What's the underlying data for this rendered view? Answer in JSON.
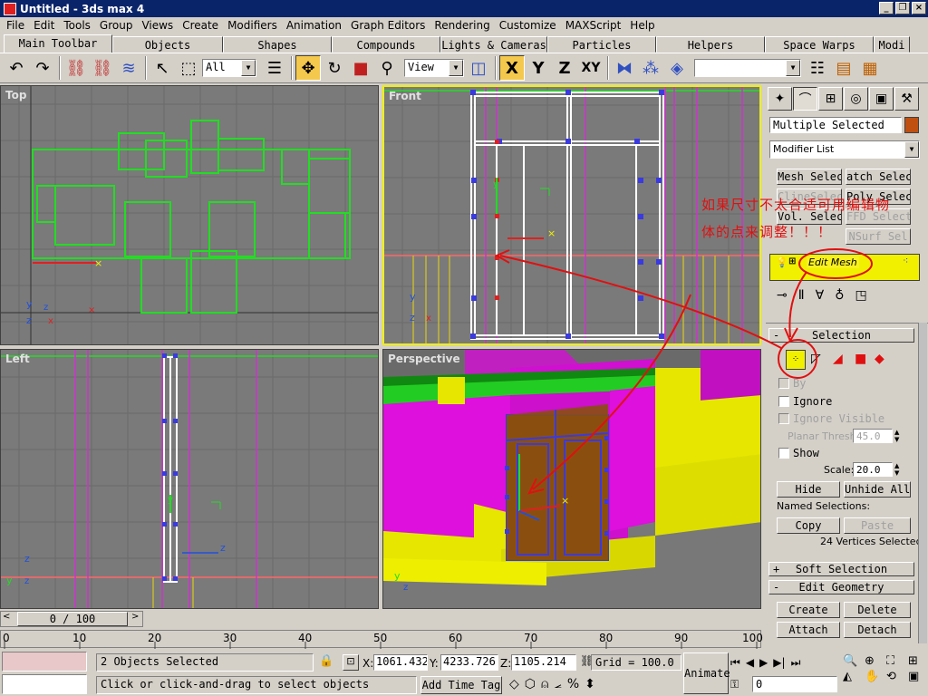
{
  "window": {
    "title": "Untitled - 3ds max 4",
    "minimize": "_",
    "restore": "❐",
    "close": "×"
  },
  "menu": [
    "File",
    "Edit",
    "Tools",
    "Group",
    "Views",
    "Create",
    "Modifiers",
    "Animation",
    "Graph Editors",
    "Rendering",
    "Customize",
    "MAXScript",
    "Help"
  ],
  "tabs": [
    "Main Toolbar",
    "Objects",
    "Shapes",
    "Compounds",
    "Lights & Cameras",
    "Particles",
    "Helpers",
    "Space Warps",
    "Modi"
  ],
  "toolbar": {
    "selection_filter": "All",
    "ref_coord": "View",
    "axis_x": "X",
    "axis_y": "Y",
    "axis_z": "Z",
    "axis_xy": "XY"
  },
  "viewports": {
    "top": "Top",
    "front": "Front",
    "left": "Left",
    "perspective": "Perspective"
  },
  "command_panel": {
    "object_name": "Multiple Selected",
    "modifier_list": "Modifier List",
    "modifier_buttons": [
      "Mesh Select",
      "atch Selec",
      "ClineSelec",
      "Poly Selec",
      "Vol. Select",
      "FFD Select",
      "NSurf Sel"
    ],
    "stack_item": "Edit Mesh",
    "selection_title": "Selection",
    "by_label": "By",
    "ignore_backfacing": "Ignore",
    "ignore_visible": "Ignore Visible",
    "planar_thresh_label": "Planar Thresh:",
    "planar_thresh_value": "45.0",
    "show_label": "Show",
    "scale_label": "Scale:",
    "scale_value": "20.0",
    "hide": "Hide",
    "unhide_all": "Unhide All",
    "named_selections": "Named Selections:",
    "copy": "Copy",
    "paste": "Paste",
    "vertices_selected": "24 Vertices Selected",
    "soft_selection": "Soft Selection",
    "edit_geometry": "Edit Geometry",
    "create": "Create",
    "delete": "Delete",
    "attach": "Attach",
    "detach": "Detach"
  },
  "annotation": {
    "line1": "如果尺寸不太合适可用编辑物",
    "line2": "体的点来调整！！！"
  },
  "timeline": {
    "frame_counter": "0 / 100",
    "ticks": [
      "0",
      "10",
      "20",
      "30",
      "40",
      "50",
      "60",
      "70",
      "80",
      "90",
      "100"
    ]
  },
  "status": {
    "objects_selected": "2 Objects Selected",
    "prompt": "Click or click-and-drag to select objects",
    "add_time_tag": "Add Time Tag",
    "x_label": "X:",
    "x_value": "1061.432",
    "y_label": "Y:",
    "y_value": "4233.726",
    "z_label": "Z:",
    "z_value": "1105.214",
    "grid": "Grid = 100.0",
    "animate": "Animate",
    "current_frame": "0"
  },
  "colors": {
    "accent_yellow": "#f0f000",
    "wire_green": "#22dd22",
    "wire_magenta": "#cc33cc",
    "titlebar": "#0a246a",
    "annotation_red": "#e01010"
  }
}
